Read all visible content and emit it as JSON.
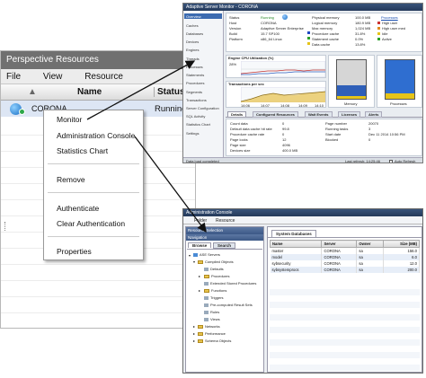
{
  "perspective": {
    "title": "Perspective Resources",
    "menu": [
      "File",
      "View",
      "Resource"
    ],
    "columns": {
      "name": "Name",
      "status": "Status"
    },
    "row": {
      "name": "CORONA",
      "status": "Running"
    }
  },
  "context_menu": {
    "items_top": [
      "Monitor",
      "Administration Console",
      "Statistics Chart"
    ],
    "remove": "Remove",
    "items_auth": [
      "Authenticate",
      "Clear Authentication"
    ],
    "properties": "Properties"
  },
  "server": {
    "title": "Adaptive Server Monitor - CORONA",
    "sidebar": [
      "Overview",
      "Caches",
      "Databases",
      "Devices",
      "Engines",
      "Threads",
      "Processes",
      "Statements",
      "Procedures",
      "Segments",
      "Transactions",
      "Server Configuration",
      "SQL Activity",
      "Statistics Chart",
      "Settings"
    ],
    "info": [
      {
        "label": "Status",
        "value": "Running"
      },
      {
        "label": "Host",
        "value": "CORONA"
      },
      {
        "label": "Version",
        "value": "Adaptive Server Enterprise"
      },
      {
        "label": "Build",
        "value": "15.7 SP100"
      },
      {
        "label": "Platform",
        "value": "x86_64 Linux"
      }
    ],
    "memory": [
      {
        "label": "Physical memory",
        "value": "100.0 MB"
      },
      {
        "label": "Logical memory",
        "value": "180.9 MB"
      },
      {
        "label": "Max memory",
        "value": "1,024 MB"
      },
      {
        "label": "Procedure cache",
        "value": "31.8%"
      },
      {
        "label": "Statement cache",
        "value": "0.0%"
      },
      {
        "label": "Data cache",
        "value": "13.8%"
      }
    ],
    "processes_label": "Processes",
    "legend": [
      "High user",
      "High user med",
      "Idle",
      "Active"
    ],
    "cpu_title": "Engine CPU Utilization (%)",
    "cpu_pct": "28%",
    "io_title": "Transactions per sec",
    "mem_label": "Memory",
    "proc_label": "Processes",
    "mem_bar": {
      "free_pct": 66,
      "used_pct": 27,
      "other_pct": 7
    },
    "proc_bar": {
      "active_pct": 85,
      "idle_pct": 15
    },
    "time_ticks": [
      "14:06",
      "14:07",
      "14:08",
      "14:09",
      "14:10"
    ],
    "tabs": [
      "Details",
      "Configured Resources",
      "Wait Events",
      "Licenses",
      "Alerts"
    ],
    "details_left": [
      {
        "label": "Count data",
        "value": "0"
      },
      {
        "label": "Default data cache hit rate",
        "value": "99.8"
      },
      {
        "label": "Procedure cache rate",
        "value": "0"
      },
      {
        "label": "Page locks",
        "value": "12"
      },
      {
        "label": "Page size",
        "value": "4096"
      },
      {
        "label": "Devices size",
        "value": "400.0 MB"
      }
    ],
    "details_right": [
      {
        "label": "Page number",
        "value": "20070"
      },
      {
        "label": "Running tasks",
        "value": "3"
      },
      {
        "label": "Start date",
        "value": "Dec 11 2014 10:56 PM"
      },
      {
        "label": "Blocked",
        "value": "0"
      }
    ],
    "status_left": "Data load completed",
    "status_right": [
      "Last refresh: 14:25:46",
      "Auto Refresh"
    ]
  },
  "console": {
    "title": "Administration Console",
    "menu": [
      "Folder",
      "Resource"
    ],
    "resource_selection": "Resource Selection",
    "navigation": "Navigation",
    "tabs": [
      "Browse",
      "Search"
    ],
    "tree": [
      "ASE Servers",
      "Compiled Objects",
      "Defaults",
      "Procedures",
      "Extended Stored Procedures",
      "Functions",
      "Triggers",
      "Pre-computed Result Sets",
      "Rules",
      "Views",
      "Networks",
      "Performance",
      "Schema Objects"
    ],
    "right_tab": "System Databases",
    "columns": [
      "Name",
      "Server",
      "Owner",
      "Size (MB)"
    ],
    "rows": [
      {
        "name": "master",
        "server": "CORONA",
        "owner": "sa",
        "size": "156.0"
      },
      {
        "name": "model",
        "server": "CORONA",
        "owner": "sa",
        "size": "6.0"
      },
      {
        "name": "sybsecurity",
        "server": "CORONA",
        "owner": "sa",
        "size": "12.0"
      },
      {
        "name": "sybsystemprocs",
        "server": "CORONA",
        "owner": "sa",
        "size": "200.0"
      }
    ]
  }
}
